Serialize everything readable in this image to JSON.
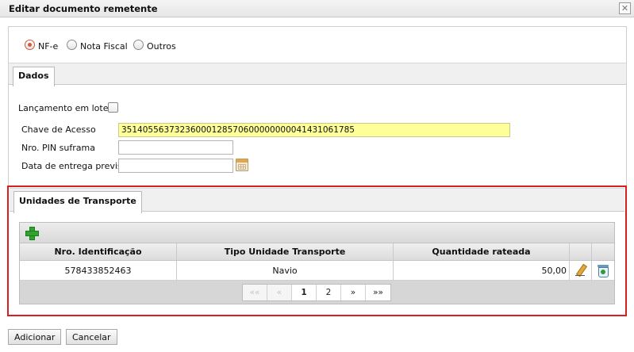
{
  "dialog": {
    "title": "Editar documento remetente",
    "close_glyph": "✕"
  },
  "doc_type": {
    "options": [
      {
        "label": "NF-e",
        "checked": true
      },
      {
        "label": "Nota Fiscal",
        "checked": false
      },
      {
        "label": "Outros",
        "checked": false
      }
    ]
  },
  "tabs": {
    "dados": "Dados",
    "unidades": "Unidades de Transporte"
  },
  "form": {
    "lote_label": "Lançamento em lote?",
    "chave_label": "Chave de Acesso",
    "chave_value": "35140556373236000128570600000000041431061785",
    "pin_label": "Nro. PIN suframa",
    "pin_value": "",
    "data_label": "Data de entrega prevista",
    "data_value": ""
  },
  "grid": {
    "columns": [
      "Nro. Identificação",
      "Tipo Unidade Transporte",
      "Quantidade rateada"
    ],
    "rows": [
      {
        "id": "578433852463",
        "tipo": "Navio",
        "qtd": "50,00"
      }
    ],
    "pager": {
      "first": "««",
      "prev": "«",
      "pages": [
        "1",
        "2"
      ],
      "current_page": "1",
      "next": "»",
      "last": "»»"
    }
  },
  "buttons": {
    "adicionar": "Adicionar",
    "cancelar": "Cancelar"
  },
  "colors": {
    "highlight_border": "#d81e1e",
    "chave_background": "#ffff99",
    "radio_accent": "#d65a36",
    "add_icon": "#2fa32f"
  }
}
